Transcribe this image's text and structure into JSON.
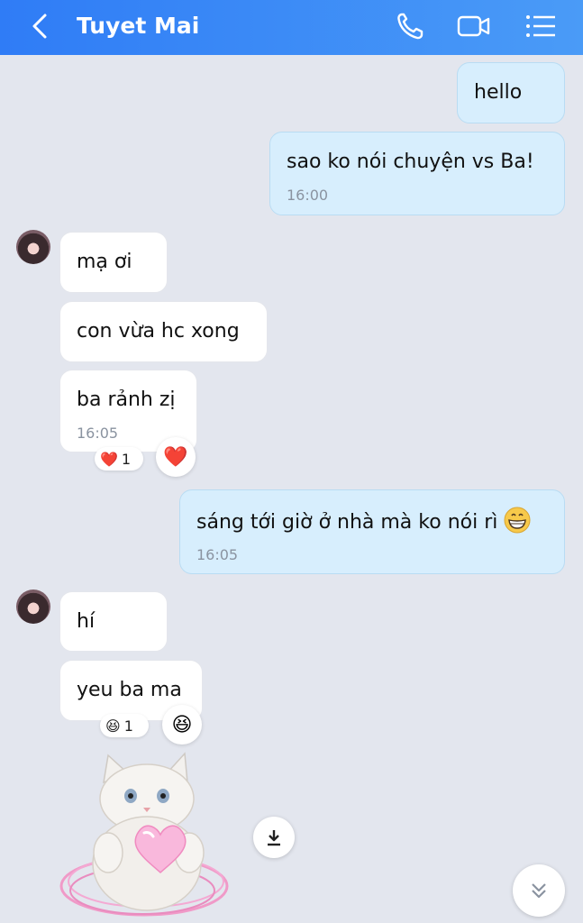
{
  "header": {
    "title": "Tuyet Mai",
    "back_icon": "chevron-left-icon",
    "call_icon": "phone-icon",
    "video_icon": "video-camera-icon",
    "menu_icon": "list-menu-icon"
  },
  "messages": [
    {
      "dir": "out",
      "text": "hello"
    },
    {
      "dir": "out",
      "text": "sao ko nói chuyện vs Ba!",
      "time": "16:00"
    },
    {
      "dir": "in",
      "text": "mạ ơi"
    },
    {
      "dir": "in",
      "text": "con vừa hc xong"
    },
    {
      "dir": "in",
      "text": "ba rảnh zị",
      "time": "16:05"
    },
    {
      "dir": "out",
      "text": "sáng tới giờ ở nhà mà ko nói rì",
      "time": "16:05"
    },
    {
      "dir": "in",
      "text": "hí"
    },
    {
      "dir": "in",
      "text": "yeu ba ma"
    }
  ],
  "reactions": [
    {
      "emoji": "❤️",
      "count": "1",
      "icon": "heart-icon"
    },
    {
      "emoji": "😆",
      "count": "1",
      "icon": "laughing-face-icon"
    }
  ],
  "sticker": {
    "icon": "cat-heart-sticker"
  },
  "controls": {
    "download_icon": "download-icon",
    "scroll_down_icon": "double-chevron-down-icon"
  },
  "colors": {
    "header": "#2f7cf6",
    "outgoing_bubble": "#d7eefd",
    "incoming_bubble": "#ffffff",
    "background": "#e3e6ee"
  }
}
